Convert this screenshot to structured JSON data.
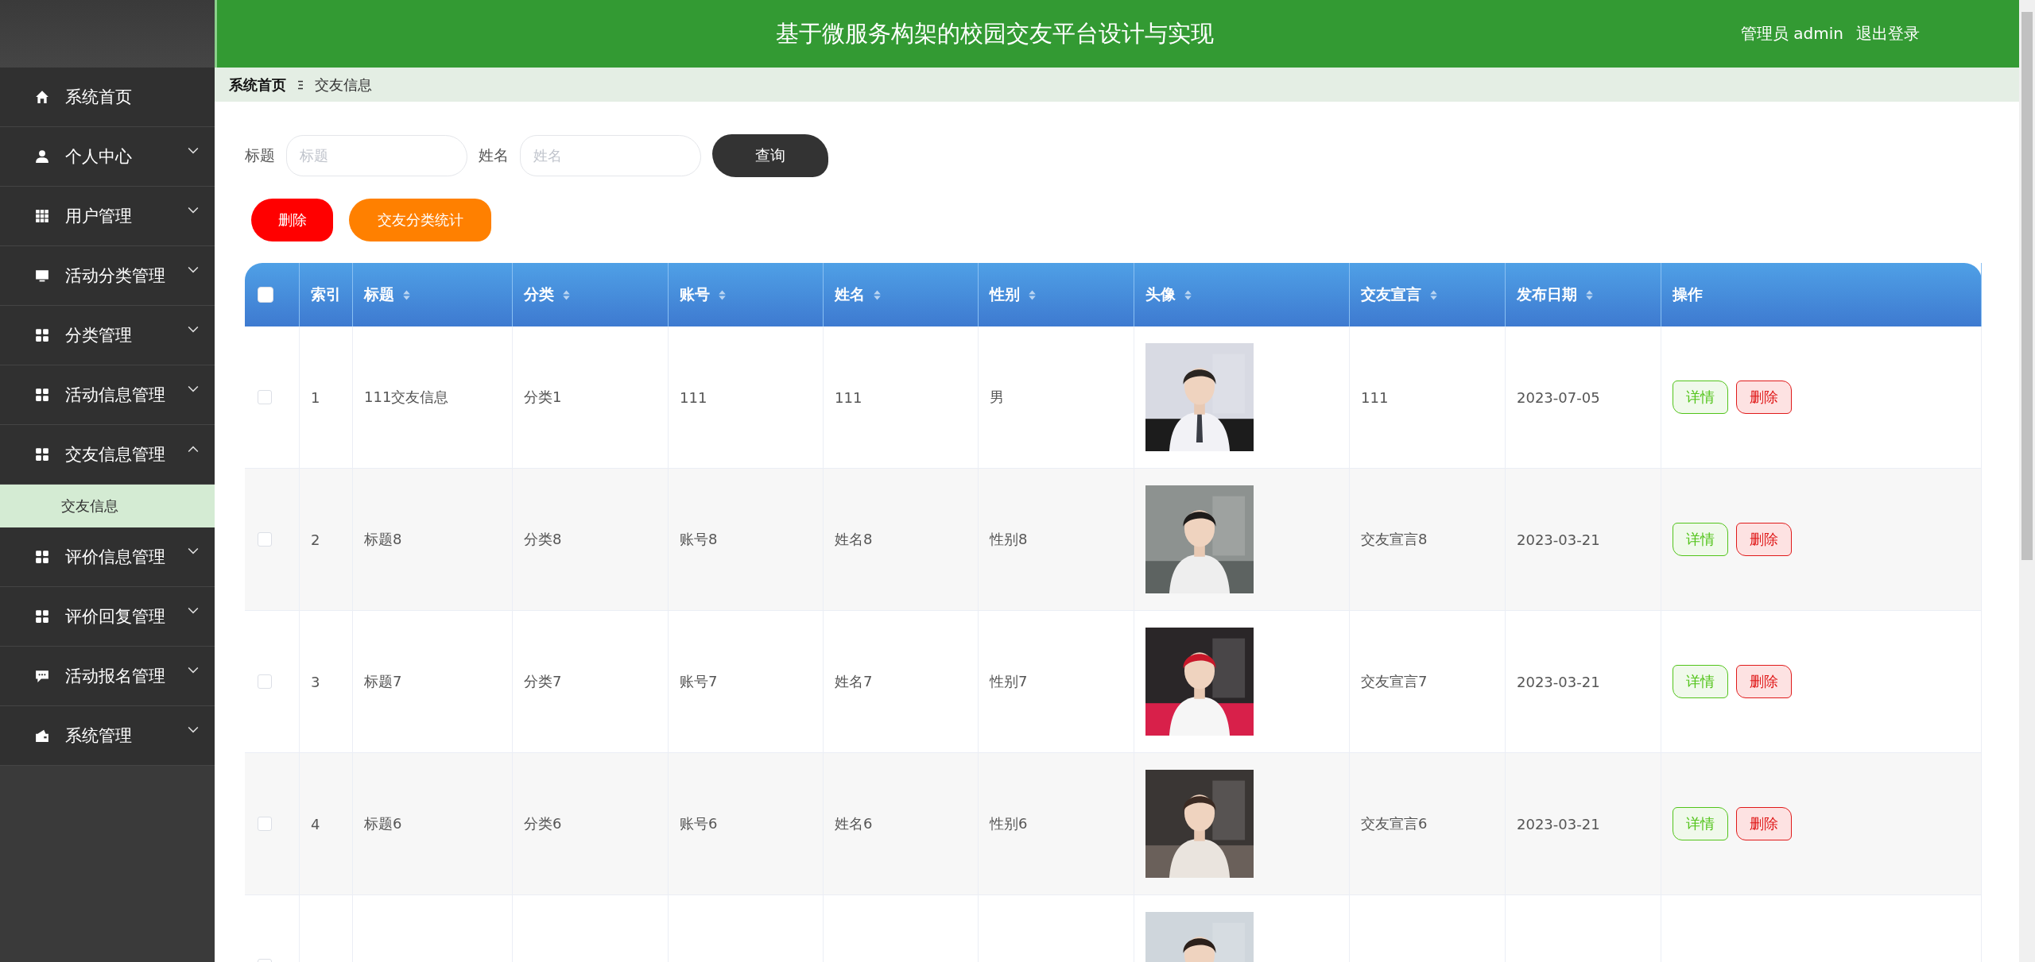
{
  "header": {
    "title": "基于微服务构架的校园交友平台设计与实现",
    "user_label": "管理员 admin",
    "logout": "退出登录"
  },
  "breadcrumb": [
    {
      "label": "系统首页"
    },
    {
      "label": "交友信息"
    }
  ],
  "sidebar": {
    "items": [
      {
        "label": "系统首页"
      },
      {
        "label": "个人中心",
        "expanded": false
      },
      {
        "label": "用户管理",
        "expanded": false
      },
      {
        "label": "活动分类管理",
        "expanded": false
      },
      {
        "label": "分类管理",
        "expanded": false
      },
      {
        "label": "活动信息管理",
        "expanded": false
      },
      {
        "label": "交友信息管理",
        "expanded": true,
        "children": [
          {
            "label": "交友信息",
            "selected": true
          }
        ]
      },
      {
        "label": "评价信息管理",
        "expanded": false
      },
      {
        "label": "评价回复管理",
        "expanded": false
      },
      {
        "label": "活动报名管理",
        "expanded": false
      },
      {
        "label": "系统管理",
        "expanded": false
      }
    ]
  },
  "search": {
    "fields": [
      {
        "label": "标题",
        "placeholder": "标题"
      },
      {
        "label": "姓名",
        "placeholder": "姓名"
      }
    ],
    "button": "查询"
  },
  "actions": [
    {
      "label": "删除",
      "kind": "danger"
    },
    {
      "label": "交友分类统计",
      "kind": "warning"
    }
  ],
  "table": {
    "select_all": {
      "checked": false
    },
    "columns": [
      {
        "label": "索引",
        "sortable": false
      },
      {
        "label": "标题",
        "sortable": true
      },
      {
        "label": "分类",
        "sortable": true
      },
      {
        "label": "账号",
        "sortable": true
      },
      {
        "label": "姓名",
        "sortable": true
      },
      {
        "label": "性别",
        "sortable": true
      },
      {
        "label": "头像",
        "sortable": true
      },
      {
        "label": "交友宣言",
        "sortable": true
      },
      {
        "label": "发布日期",
        "sortable": true
      },
      {
        "label": "操作",
        "sortable": false
      }
    ],
    "rows": [
      {
        "checked": false,
        "index": "1",
        "title": "111交友信息",
        "category": "分类1",
        "account": "111",
        "name": "111",
        "gender": "男",
        "motto": "111",
        "date": "2023-07-05",
        "buttons": [
          "详情",
          "删除"
        ]
      },
      {
        "checked": false,
        "index": "2",
        "title": "标题8",
        "category": "分类8",
        "account": "账号8",
        "name": "姓名8",
        "gender": "性别8",
        "motto": "交友宣言8",
        "date": "2023-03-21",
        "buttons": [
          "详情",
          "删除"
        ]
      },
      {
        "checked": false,
        "index": "3",
        "title": "标题7",
        "category": "分类7",
        "account": "账号7",
        "name": "姓名7",
        "gender": "性别7",
        "motto": "交友宣言7",
        "date": "2023-03-21",
        "buttons": [
          "详情",
          "删除"
        ]
      },
      {
        "checked": false,
        "index": "4",
        "title": "标题6",
        "category": "分类6",
        "account": "账号6",
        "name": "姓名6",
        "gender": "性别6",
        "motto": "交友宣言6",
        "date": "2023-03-21",
        "buttons": [
          "详情",
          "删除"
        ]
      },
      {
        "checked": false
      }
    ]
  }
}
